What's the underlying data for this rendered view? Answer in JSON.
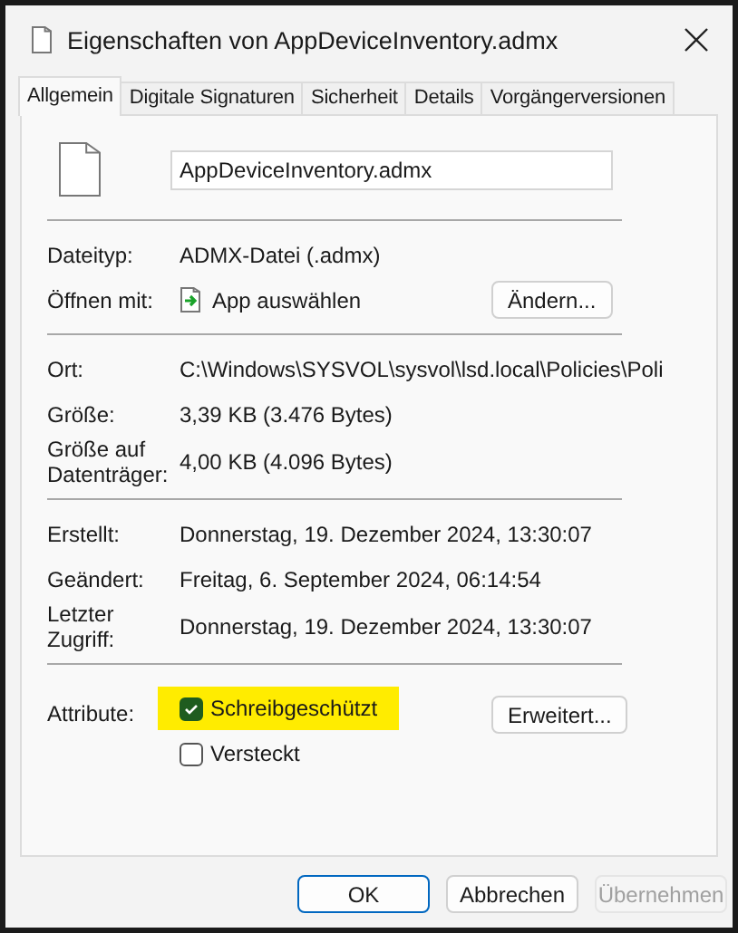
{
  "window": {
    "title": "Eigenschaften von AppDeviceInventory.admx"
  },
  "tabs": [
    {
      "label": "Allgemein",
      "selected": true
    },
    {
      "label": "Digitale Signaturen",
      "selected": false
    },
    {
      "label": "Sicherheit",
      "selected": false
    },
    {
      "label": "Details",
      "selected": false
    },
    {
      "label": "Vorgängerversionen",
      "selected": false
    }
  ],
  "file_name": {
    "value": "AppDeviceInventory.admx"
  },
  "sections": [
    [
      {
        "kind": "text",
        "label": "Dateityp:",
        "value": "ADMX-Datei (.admx)"
      },
      {
        "kind": "openwith",
        "label": "Öffnen mit:",
        "value": "App auswählen",
        "button": "Ändern..."
      }
    ],
    [
      {
        "kind": "text",
        "label": "Ort:",
        "value": "C:\\Windows\\SYSVOL\\sysvol\\lsd.local\\Policies\\Poli"
      },
      {
        "kind": "text",
        "label": "Größe:",
        "value": "3,39 KB (3.476 Bytes)"
      },
      {
        "kind": "text",
        "label": "Größe auf Datenträger:",
        "value": "4,00 KB (4.096 Bytes)"
      }
    ],
    [
      {
        "kind": "text",
        "label": "Erstellt:",
        "value": "Donnerstag, 19. Dezember 2024, 13:30:07"
      },
      {
        "kind": "text",
        "label": "Geändert:",
        "value": "Freitag, 6. September 2024, 06:14:54"
      },
      {
        "kind": "text",
        "label": "Letzter Zugriff:",
        "value": "Donnerstag, 19. Dezember 2024, 13:30:07"
      }
    ],
    [
      {
        "kind": "attributes",
        "label": "Attribute:",
        "button": "Erweitert...",
        "options": [
          {
            "label": "Schreibgeschützt",
            "checked": true,
            "highlighted": true
          },
          {
            "label": "Versteckt",
            "checked": false,
            "highlighted": false
          }
        ]
      }
    ]
  ],
  "buttons": [
    {
      "label": "OK",
      "default": true,
      "disabled": false
    },
    {
      "label": "Abbrechen",
      "default": false,
      "disabled": false
    },
    {
      "label": "Übernehmen",
      "default": false,
      "disabled": true
    }
  ]
}
